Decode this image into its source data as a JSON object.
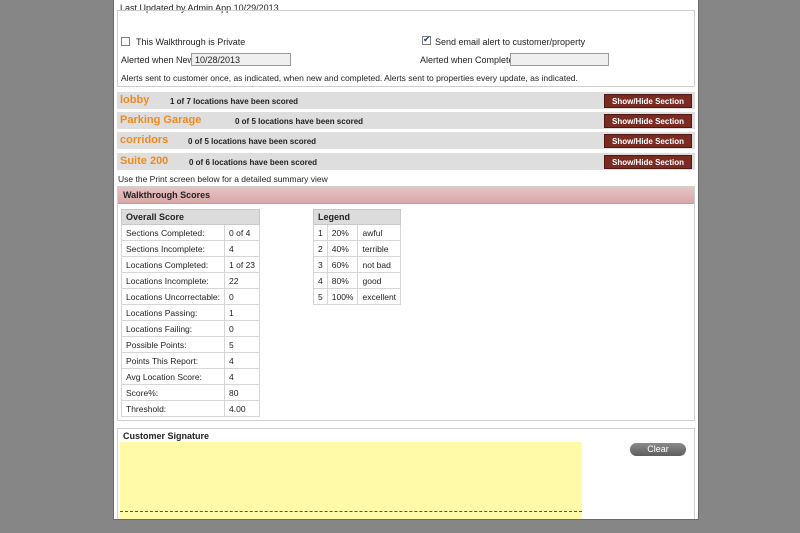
{
  "header": {
    "last_updated": "Last Updated by Admin App 10/29/2013"
  },
  "options": {
    "private_label": "This Walkthrough is Private",
    "private_checked": false,
    "email_alert_label": "Send email alert to customer/property",
    "email_alert_checked": true,
    "alerted_new_label": "Alerted when New",
    "alerted_new_value": "10/28/2013",
    "alerted_complete_label": "Alerted when Complete",
    "alerted_complete_value": "",
    "alerts_note": "Alerts sent to customer once, as indicated, when new and completed. Alerts sent to properties every update, as indicated."
  },
  "sections": [
    {
      "name": "lobby",
      "summary": "1 of 7 locations have been scored",
      "button": "Show/Hide Section"
    },
    {
      "name": "Parking Garage",
      "summary": "0 of 5 locations have been scored",
      "button": "Show/Hide Section"
    },
    {
      "name": "corridors",
      "summary": "0 of 5 locations have been scored",
      "button": "Show/Hide Section"
    },
    {
      "name": "Suite 200",
      "summary": "0 of 6 locations have been scored",
      "button": "Show/Hide Section"
    }
  ],
  "print_note": "Use the Print screen below for a detailed summary view",
  "scores": {
    "title": "Walkthrough Scores",
    "overall_header": "Overall Score",
    "overall_rows": [
      {
        "label": "Sections Completed:",
        "value": "0 of 4"
      },
      {
        "label": "Sections Incomplete:",
        "value": "4"
      },
      {
        "label": "Locations Completed:",
        "value": "1 of 23"
      },
      {
        "label": "Locations Incomplete:",
        "value": "22"
      },
      {
        "label": "Locations Uncorrectable:",
        "value": "0"
      },
      {
        "label": "Locations Passing:",
        "value": "1"
      },
      {
        "label": "Locations Failing:",
        "value": "0"
      },
      {
        "label": "Possible Points:",
        "value": "5"
      },
      {
        "label": "Points This Report:",
        "value": "4"
      },
      {
        "label": "Avg Location Score:",
        "value": "4"
      },
      {
        "label": "Score%:",
        "value": "80"
      },
      {
        "label": "Threshold:",
        "value": "4.00"
      }
    ],
    "legend_header": "Legend",
    "legend_rows": [
      {
        "n": "1",
        "pct": "20%",
        "label": "awful"
      },
      {
        "n": "2",
        "pct": "40%",
        "label": "terrible"
      },
      {
        "n": "3",
        "pct": "60%",
        "label": "not bad"
      },
      {
        "n": "4",
        "pct": "80%",
        "label": "good"
      },
      {
        "n": "5",
        "pct": "100%",
        "label": "excellent"
      }
    ]
  },
  "signature": {
    "title": "Customer Signature",
    "clear_label": "Clear"
  },
  "colors": {
    "section_name": "#ef8a1d",
    "button_bg": "#7a2b22",
    "signature_bg": "#fffaa8",
    "scores_header_bg": "#dcb0b0"
  }
}
